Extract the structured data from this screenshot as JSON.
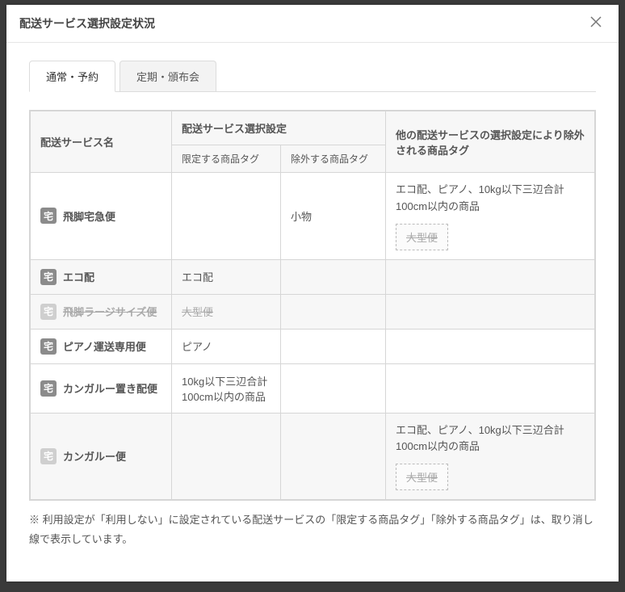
{
  "modal": {
    "title": "配送サービス選択設定状況"
  },
  "tabs": [
    {
      "label": "通常・予約",
      "active": true
    },
    {
      "label": "定期・頒布会",
      "active": false
    }
  ],
  "header": {
    "col_service": "配送サービス名",
    "col_selection": "配送サービス選択設定",
    "col_limit": "限定する商品タグ",
    "col_exclude": "除外する商品タグ",
    "col_others": "他の配送サービスの選択設定により除外される商品タグ"
  },
  "icon_label": "宅",
  "rows": [
    {
      "service": "飛脚宅急便",
      "icon_disabled": false,
      "service_disabled": false,
      "limit": "",
      "limit_struck": false,
      "exclude": "小物",
      "others_text": "エコ配、ピアノ、10kg以下三辺合計100cm以内の商品",
      "others_tag": "大型便",
      "grey": false
    },
    {
      "service": "エコ配",
      "icon_disabled": false,
      "service_disabled": false,
      "limit": "エコ配",
      "limit_struck": false,
      "exclude": "",
      "others_text": "",
      "others_tag": "",
      "grey": true
    },
    {
      "service": "飛脚ラージサイズ便",
      "icon_disabled": true,
      "service_disabled": true,
      "limit": "大型便",
      "limit_struck": true,
      "exclude": "",
      "others_text": "",
      "others_tag": "",
      "grey": true
    },
    {
      "service": "ピアノ運送専用便",
      "icon_disabled": false,
      "service_disabled": false,
      "limit": "ピアノ",
      "limit_struck": false,
      "exclude": "",
      "others_text": "",
      "others_tag": "",
      "grey": false
    },
    {
      "service": "カンガルー置き配便",
      "icon_disabled": false,
      "service_disabled": false,
      "limit": "10kg以下三辺合計100cm以内の商品",
      "limit_struck": false,
      "exclude": "",
      "others_text": "",
      "others_tag": "",
      "grey": false
    },
    {
      "service": "カンガルー便",
      "icon_disabled": true,
      "service_disabled": false,
      "limit": "",
      "limit_struck": false,
      "exclude": "",
      "others_text": "エコ配、ピアノ、10kg以下三辺合計100cm以内の商品",
      "others_tag": "大型便",
      "grey": true
    }
  ],
  "footnote": "※ 利用設定が「利用しない」に設定されている配送サービスの「限定する商品タグ」「除外する商品タグ」は、取り消し線で表示しています。"
}
